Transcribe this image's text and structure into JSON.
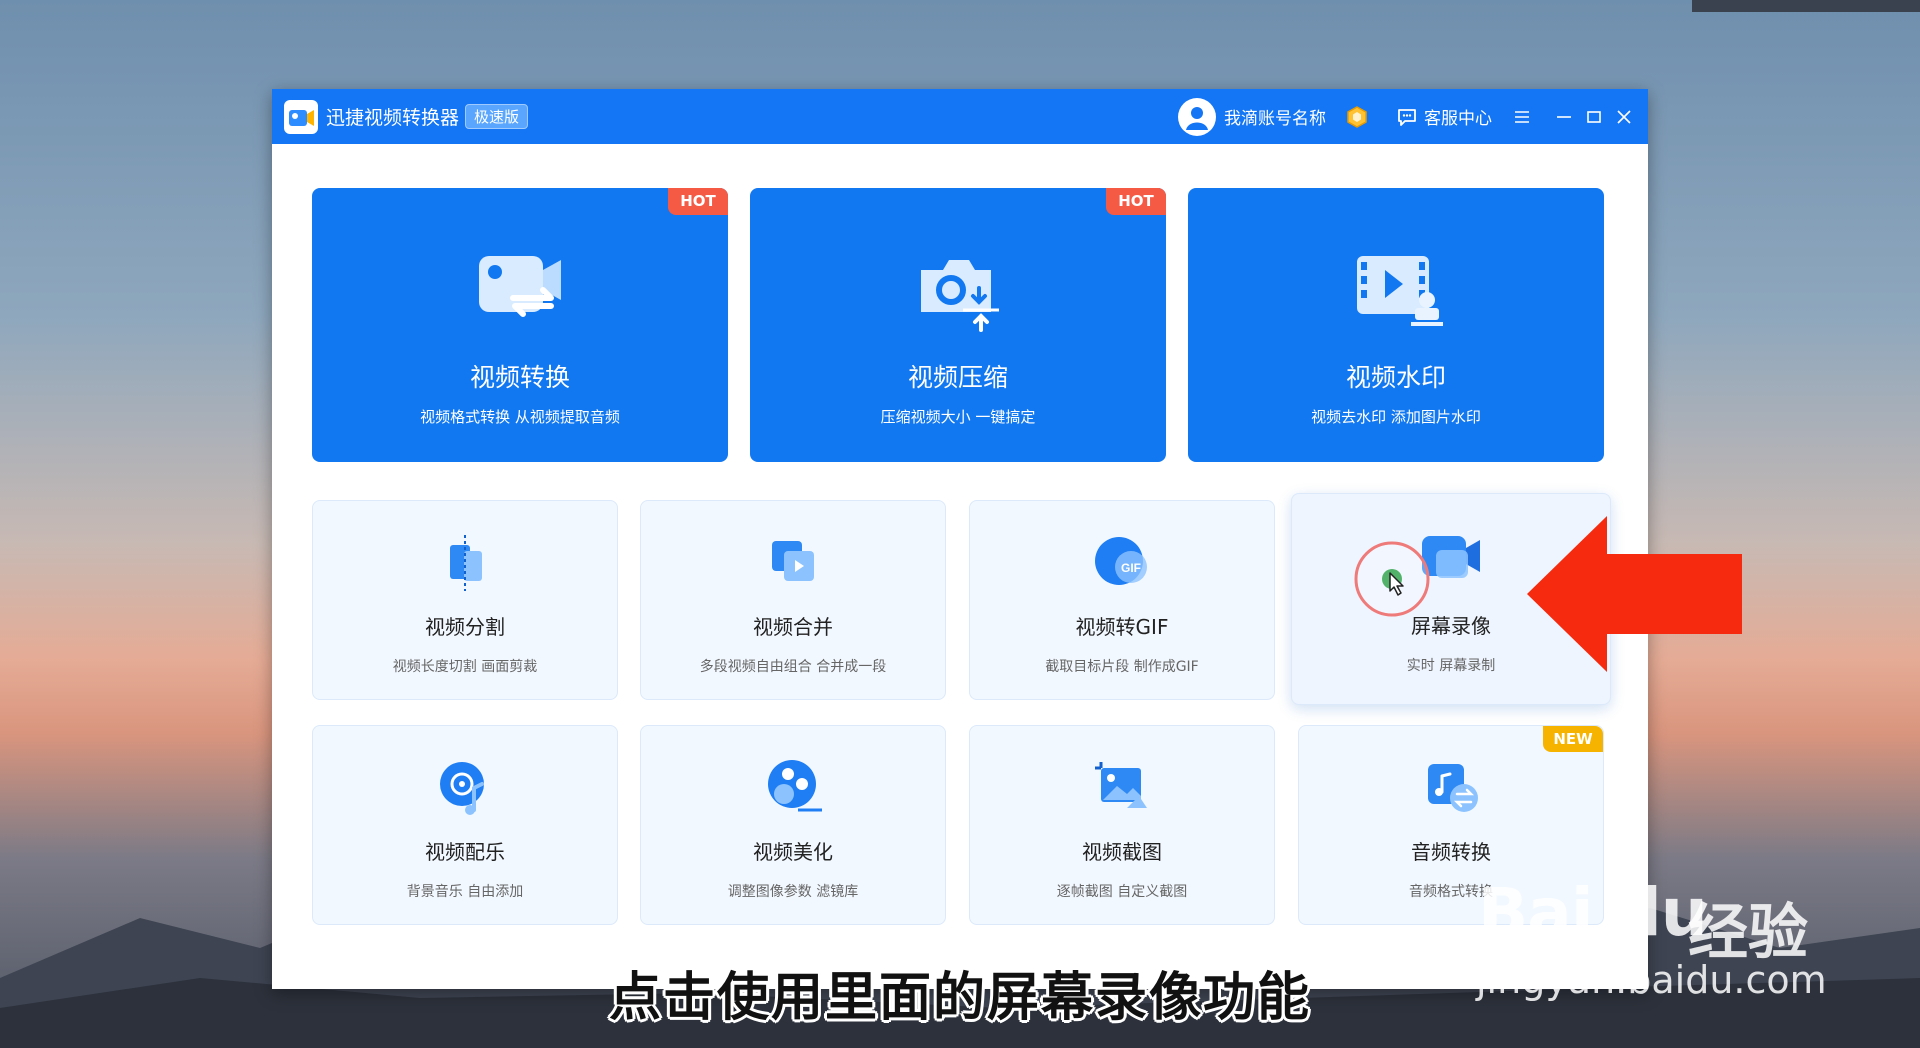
{
  "window": {
    "title": "迅捷视频转换器",
    "edition_badge": "极速版",
    "account_name": "我滴账号名称",
    "service_label": "客服中心"
  },
  "features_big": [
    {
      "title": "视频转换",
      "subtitle": "视频格式转换 从视频提取音频",
      "badge": "HOT",
      "icon": "video-convert-icon"
    },
    {
      "title": "视频压缩",
      "subtitle": "压缩视频大小 一键搞定",
      "badge": "HOT",
      "icon": "video-compress-icon"
    },
    {
      "title": "视频水印",
      "subtitle": "视频去水印 添加图片水印",
      "icon": "video-watermark-icon"
    }
  ],
  "features_row1": [
    {
      "title": "视频分割",
      "subtitle": "视频长度切割 画面剪裁",
      "icon": "video-split-icon"
    },
    {
      "title": "视频合并",
      "subtitle": "多段视频自由组合 合并成一段",
      "icon": "video-merge-icon"
    },
    {
      "title": "视频转GIF",
      "subtitle": "截取目标片段 制作成GIF",
      "icon": "gif-icon",
      "icon_text": "GIF"
    },
    {
      "title": "屏幕录像",
      "subtitle": "实时 屏幕录制",
      "icon": "screen-record-icon"
    }
  ],
  "features_row2": [
    {
      "title": "视频配乐",
      "subtitle": "背景音乐 自由添加",
      "icon": "video-music-icon"
    },
    {
      "title": "视频美化",
      "subtitle": "调整图像参数 滤镜库",
      "icon": "video-beautify-icon"
    },
    {
      "title": "视频截图",
      "subtitle": "逐帧截图 自定义截图",
      "icon": "video-screenshot-icon"
    },
    {
      "title": "音频转换",
      "subtitle": "音频格式转换",
      "badge": "NEW",
      "icon": "audio-convert-icon"
    }
  ],
  "caption": "点击使用里面的屏幕录像功能",
  "watermark": {
    "brand": "Bai du",
    "brand_cn": "经验",
    "url": "jingyan.baidu.com"
  },
  "colors": {
    "titlebar": "#1476f5",
    "card_blue": "#1278f2",
    "hot": "#f55a45",
    "new": "#f6b400",
    "arrow": "#f52a0e"
  }
}
